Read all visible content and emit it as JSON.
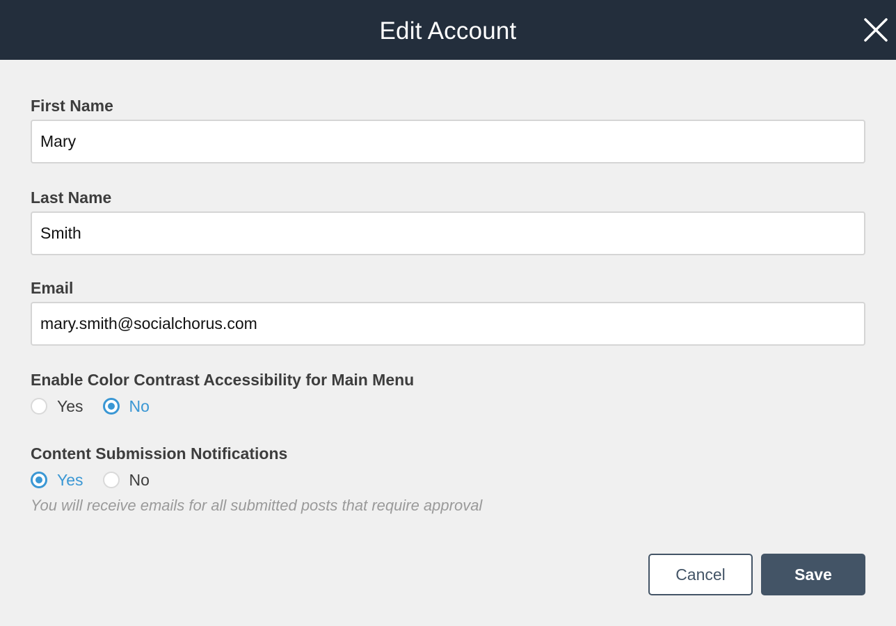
{
  "header": {
    "title": "Edit Account",
    "close_icon": "close-icon"
  },
  "form": {
    "first_name": {
      "label": "First Name",
      "value": "Mary"
    },
    "last_name": {
      "label": "Last Name",
      "value": "Smith"
    },
    "email": {
      "label": "Email",
      "value": "mary.smith@socialchorus.com"
    },
    "color_contrast": {
      "label": "Enable Color Contrast Accessibility for Main Menu",
      "options": [
        "Yes",
        "No"
      ],
      "selected": "No"
    },
    "content_notifications": {
      "label": "Content Submission Notifications",
      "options": [
        "Yes",
        "No"
      ],
      "selected": "Yes",
      "help_text": "You will receive emails for all submitted posts that require approval"
    }
  },
  "actions": {
    "cancel_label": "Cancel",
    "save_label": "Save"
  },
  "colors": {
    "header_bg": "#232e3c",
    "accent": "#3a97d4",
    "button_primary": "#435466"
  }
}
